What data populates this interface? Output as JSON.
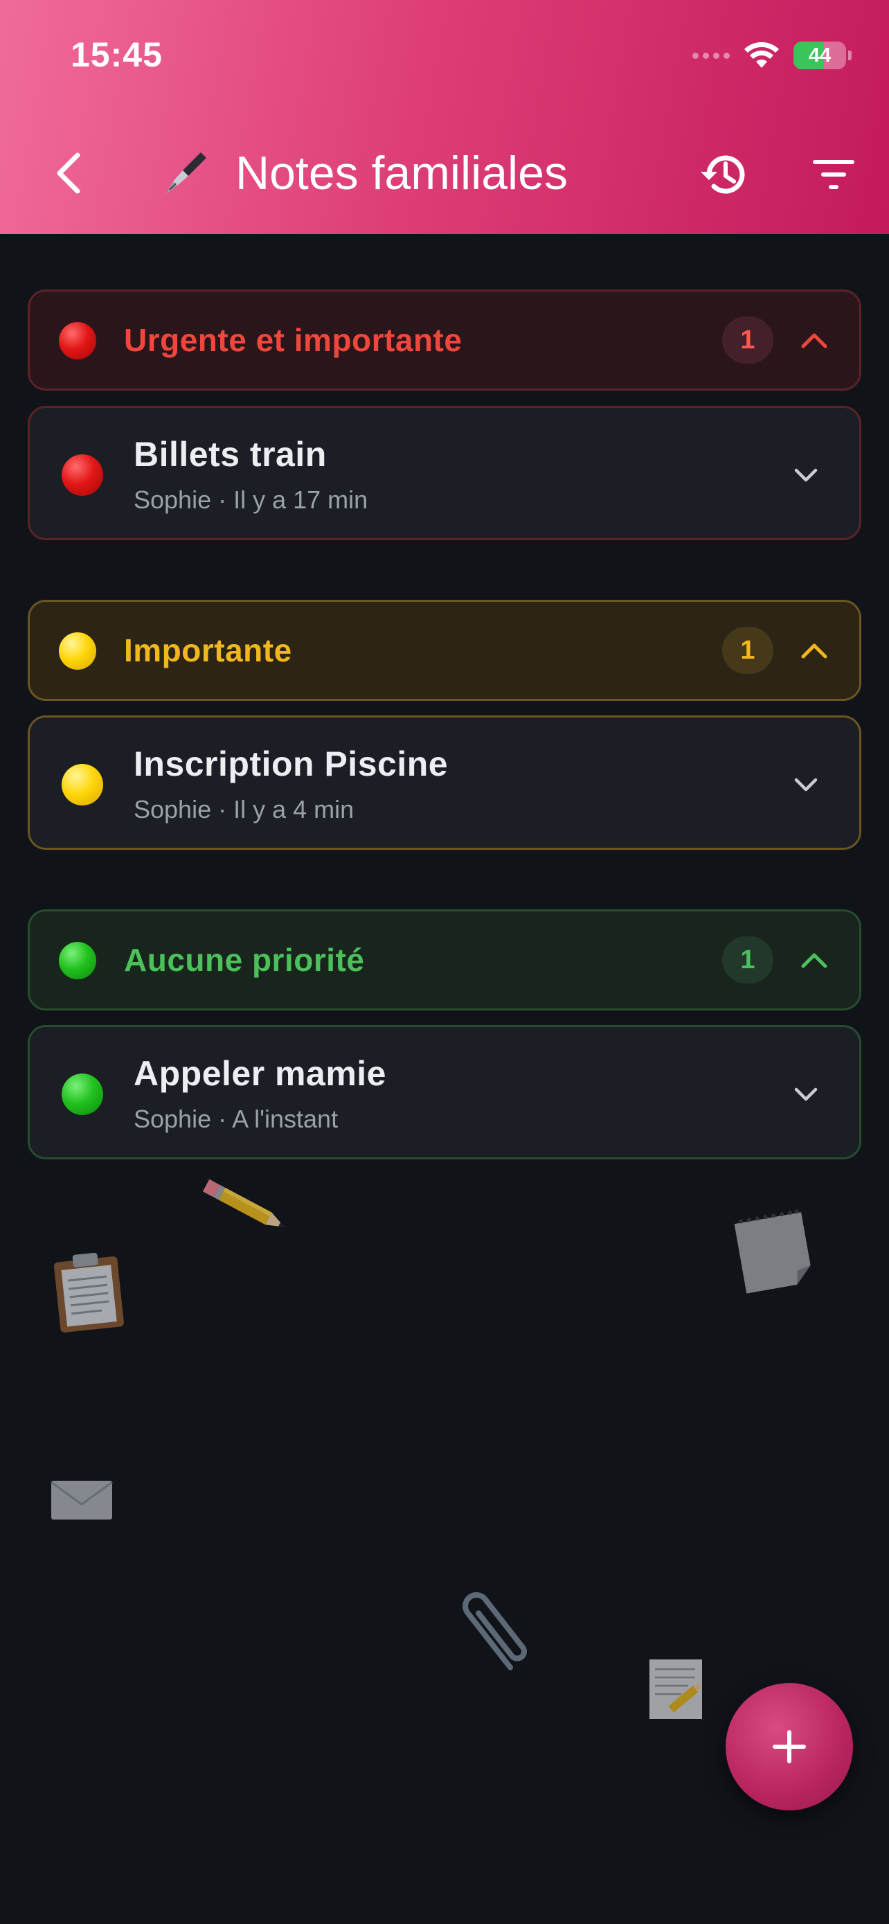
{
  "status_bar": {
    "time": "15:45",
    "battery": "44"
  },
  "header": {
    "title": "Notes familiales",
    "title_icon": "fountain-pen-icon",
    "back_icon": "chevron-left-icon",
    "history_icon": "history-icon",
    "filter_icon": "filter-icon"
  },
  "groups": [
    {
      "title": "Urgente et importante",
      "count": "1",
      "color": "#f0473d",
      "notes": [
        {
          "title": "Billets train",
          "meta": "Sophie · Il y a 17 min"
        }
      ]
    },
    {
      "title": "Importante",
      "count": "1",
      "color": "#f2b71e",
      "notes": [
        {
          "title": "Inscription Piscine",
          "meta": "Sophie · Il y a 4 min"
        }
      ]
    },
    {
      "title": "Aucune priorité",
      "count": "1",
      "color": "#4cc05a",
      "notes": [
        {
          "title": "Appeler mamie",
          "meta": "Sophie · A l'instant"
        }
      ]
    }
  ],
  "fab": {
    "icon": "plus-icon"
  },
  "decorations": [
    "pencil-icon",
    "clipboard-icon",
    "notepad-icon",
    "envelope-icon",
    "paperclip-icon",
    "memo-icon"
  ]
}
